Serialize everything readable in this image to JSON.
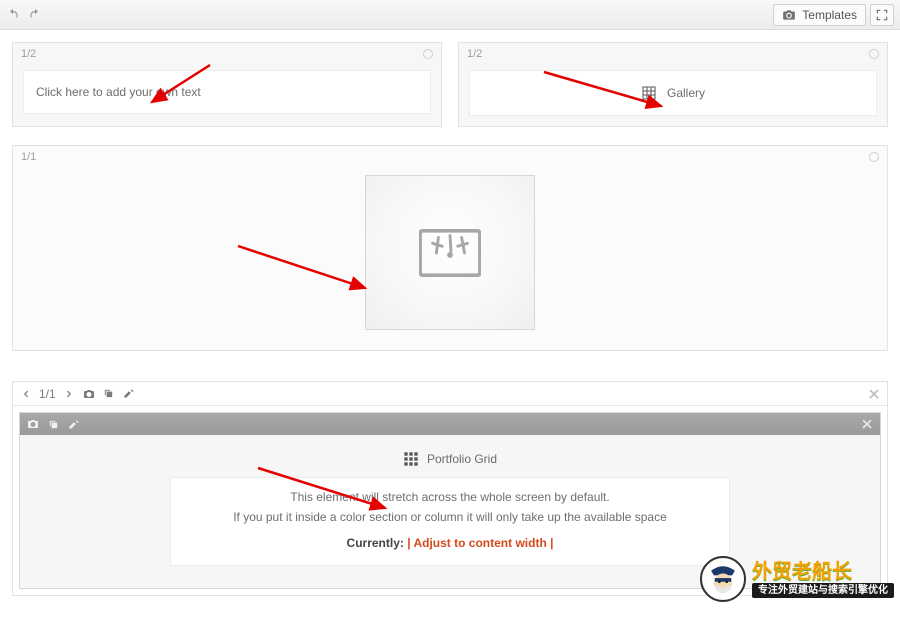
{
  "topbar": {
    "templates_label": "Templates"
  },
  "columns": {
    "half_label": "1/2",
    "full_label": "1/1",
    "text_placeholder": "Click here to add your own text",
    "gallery_label": "Gallery"
  },
  "section": {
    "nav_label": "1/1",
    "portfolio_title": "Portfolio Grid",
    "msg_line1": "This element will stretch across the whole screen by default.",
    "msg_line2": "If you put it inside a color section or column it will only take up the available space",
    "currently_label": "Currently:",
    "currently_value": "| Adjust to content width |"
  },
  "watermark": {
    "title_cn": "外贸老船长",
    "subtitle_cn": "专注外贸建站与搜索引擎优化"
  }
}
